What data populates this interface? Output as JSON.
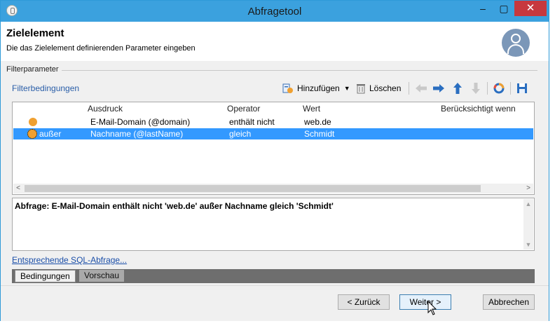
{
  "window": {
    "title": "Abfragetool"
  },
  "titlebar": {
    "minimize": "–",
    "maximize": "▢",
    "close": "✕"
  },
  "header": {
    "title": "Zielelement",
    "subtitle": "Die das Zielelement definierenden Parameter eingeben"
  },
  "filter_section": {
    "label": "Filterparameter",
    "link": "Filterbedingungen"
  },
  "toolbar": {
    "add_label": "Hinzufügen",
    "delete_label": "Löschen"
  },
  "grid": {
    "columns": [
      "Ausdruck",
      "Operator",
      "Wert",
      "Berücksichtigt wenn"
    ],
    "rows": [
      {
        "logic": "",
        "expression": "E-Mail-Domain (@domain)",
        "operator": "enthält nicht",
        "value": "web.de",
        "selected": false
      },
      {
        "logic": "außer",
        "expression": "Nachname (@lastName)",
        "operator": "gleich",
        "value": "Schmidt",
        "selected": true
      }
    ]
  },
  "query": {
    "text": "Abfrage: E-Mail-Domain enthält nicht 'web.de' außer Nachname gleich 'Schmidt'"
  },
  "sql_link": "Entsprechende SQL-Abfrage...",
  "tabs": [
    {
      "label": "Bedingungen",
      "active": true
    },
    {
      "label": "Vorschau",
      "active": false
    }
  ],
  "buttons": {
    "back": "< Zurück",
    "next": "Weiter >",
    "cancel": "Abbrechen"
  },
  "colors": {
    "titlebar": "#3ba1de",
    "selection": "#3399ff",
    "link": "#2a5ea8",
    "close": "#c7383e",
    "condition_dot": "#f0a030"
  }
}
